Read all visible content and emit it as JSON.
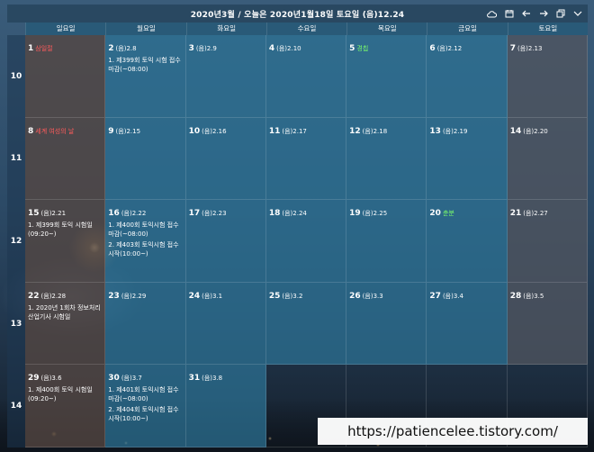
{
  "header": {
    "title": "2020년3월 / 오늘은 2020년1월18일 토요일 (음)12.24",
    "tools": [
      "cloud-icon",
      "calendar-icon",
      "arrow-left-icon",
      "arrow-right-icon",
      "window-icon",
      "chevron-down-icon"
    ]
  },
  "days": [
    "일요일",
    "월요일",
    "화요일",
    "수요일",
    "목요일",
    "금요일",
    "토요일"
  ],
  "weeks": [
    "10",
    "11",
    "12",
    "13",
    "14"
  ],
  "cells": [
    {
      "d": "1",
      "l": "",
      "h": "삼일절",
      "hc": "red",
      "ev": []
    },
    {
      "d": "2",
      "l": "(음)2.8",
      "h": "",
      "hc": "",
      "ev": [
        "1. 제399회 토익 시험 접수 마감(~08:00)"
      ]
    },
    {
      "d": "3",
      "l": "(음)2.9",
      "h": "",
      "hc": "",
      "ev": []
    },
    {
      "d": "4",
      "l": "(음)2.10",
      "h": "",
      "hc": "",
      "ev": []
    },
    {
      "d": "5",
      "l": "",
      "h": "경칩",
      "hc": "green",
      "ev": []
    },
    {
      "d": "6",
      "l": "(음)2.12",
      "h": "",
      "hc": "",
      "ev": []
    },
    {
      "d": "7",
      "l": "(음)2.13",
      "h": "",
      "hc": "",
      "ev": []
    },
    {
      "d": "8",
      "l": "",
      "h": "세계 여성의 날",
      "hc": "red",
      "ev": []
    },
    {
      "d": "9",
      "l": "(음)2.15",
      "h": "",
      "hc": "",
      "ev": []
    },
    {
      "d": "10",
      "l": "(음)2.16",
      "h": "",
      "hc": "",
      "ev": []
    },
    {
      "d": "11",
      "l": "(음)2.17",
      "h": "",
      "hc": "",
      "ev": []
    },
    {
      "d": "12",
      "l": "(음)2.18",
      "h": "",
      "hc": "",
      "ev": []
    },
    {
      "d": "13",
      "l": "(음)2.19",
      "h": "",
      "hc": "",
      "ev": []
    },
    {
      "d": "14",
      "l": "(음)2.20",
      "h": "",
      "hc": "",
      "ev": []
    },
    {
      "d": "15",
      "l": "(음)2.21",
      "h": "",
      "hc": "",
      "ev": [
        "1. 제399회 토익 시험일 (09:20~)"
      ]
    },
    {
      "d": "16",
      "l": "(음)2.22",
      "h": "",
      "hc": "",
      "ev": [
        "1. 제400회 토익시험 접수 마감(~08:00)",
        "2. 제403회 토익시험 접수 시작(10:00~)"
      ]
    },
    {
      "d": "17",
      "l": "(음)2.23",
      "h": "",
      "hc": "",
      "ev": []
    },
    {
      "d": "18",
      "l": "(음)2.24",
      "h": "",
      "hc": "",
      "ev": []
    },
    {
      "d": "19",
      "l": "(음)2.25",
      "h": "",
      "hc": "",
      "ev": []
    },
    {
      "d": "20",
      "l": "",
      "h": "춘분",
      "hc": "green",
      "ev": []
    },
    {
      "d": "21",
      "l": "(음)2.27",
      "h": "",
      "hc": "",
      "ev": []
    },
    {
      "d": "22",
      "l": "(음)2.28",
      "h": "",
      "hc": "",
      "ev": [
        "1. 2020년 1회차 정보처리 산업기사 시험일"
      ]
    },
    {
      "d": "23",
      "l": "(음)2.29",
      "h": "",
      "hc": "",
      "ev": []
    },
    {
      "d": "24",
      "l": "(음)3.1",
      "h": "",
      "hc": "",
      "ev": []
    },
    {
      "d": "25",
      "l": "(음)3.2",
      "h": "",
      "hc": "",
      "ev": []
    },
    {
      "d": "26",
      "l": "(음)3.3",
      "h": "",
      "hc": "",
      "ev": []
    },
    {
      "d": "27",
      "l": "(음)3.4",
      "h": "",
      "hc": "",
      "ev": []
    },
    {
      "d": "28",
      "l": "(음)3.5",
      "h": "",
      "hc": "",
      "ev": []
    },
    {
      "d": "29",
      "l": "(음)3.6",
      "h": "",
      "hc": "",
      "ev": [
        "1. 제400회 토익 시험일 (09:20~)"
      ]
    },
    {
      "d": "30",
      "l": "(음)3.7",
      "h": "",
      "hc": "",
      "ev": [
        "1. 제401회 토익시험 접수 마감(~08:00)",
        "2. 제404회 토익시험 접수 시작(10:00~)"
      ]
    },
    {
      "d": "31",
      "l": "(음)3.8",
      "h": "",
      "hc": "",
      "ev": []
    }
  ],
  "watermark": "https://patiencelee.tistory.com/"
}
